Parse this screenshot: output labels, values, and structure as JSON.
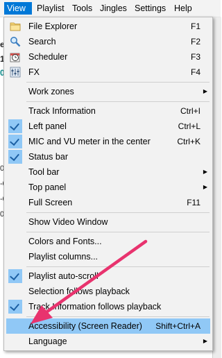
{
  "menubar": {
    "items": [
      "View",
      "Playlist",
      "Tools",
      "Jingles",
      "Settings",
      "Help"
    ],
    "active": "View"
  },
  "background": {
    "fragments": [
      "e",
      "1",
      "0",
      "0",
      "-0",
      "-0",
      "00"
    ]
  },
  "menu": {
    "items": [
      {
        "label": "File Explorer",
        "shortcut": "F1",
        "icon": "folder-icon"
      },
      {
        "label": "Search",
        "shortcut": "F2",
        "icon": "magnifier-icon"
      },
      {
        "label": "Scheduler",
        "shortcut": "F3",
        "icon": "clock-icon"
      },
      {
        "label": "FX",
        "shortcut": "F4",
        "icon": "equalizer-icon"
      },
      {
        "label": "Work zones",
        "submenu": true
      },
      {
        "label": "Track Information",
        "shortcut": "Ctrl+I"
      },
      {
        "label": "Left panel",
        "shortcut": "Ctrl+L",
        "checked": true
      },
      {
        "label": "MIC and VU meter in the center",
        "shortcut": "Ctrl+K",
        "checked": true
      },
      {
        "label": "Status bar",
        "checked": true
      },
      {
        "label": "Tool bar",
        "submenu": true
      },
      {
        "label": "Top panel",
        "submenu": true
      },
      {
        "label": "Full Screen",
        "shortcut": "F11"
      },
      {
        "label": "Show Video Window"
      },
      {
        "label": "Colors and Fonts..."
      },
      {
        "label": "Playlist columns..."
      },
      {
        "label": "Playlist auto-scroll",
        "checked": true
      },
      {
        "label": "Selection follows playback"
      },
      {
        "label": "Track Information follows playback",
        "checked": true
      },
      {
        "label": "Accessibility (Screen Reader)",
        "shortcut": "Shift+Ctrl+A",
        "highlighted": true
      },
      {
        "label": "Language",
        "submenu": true
      }
    ]
  },
  "colors": {
    "highlight": "#90c8f6",
    "menubar_active": "#0078d7",
    "arrow": "#e8336e"
  }
}
